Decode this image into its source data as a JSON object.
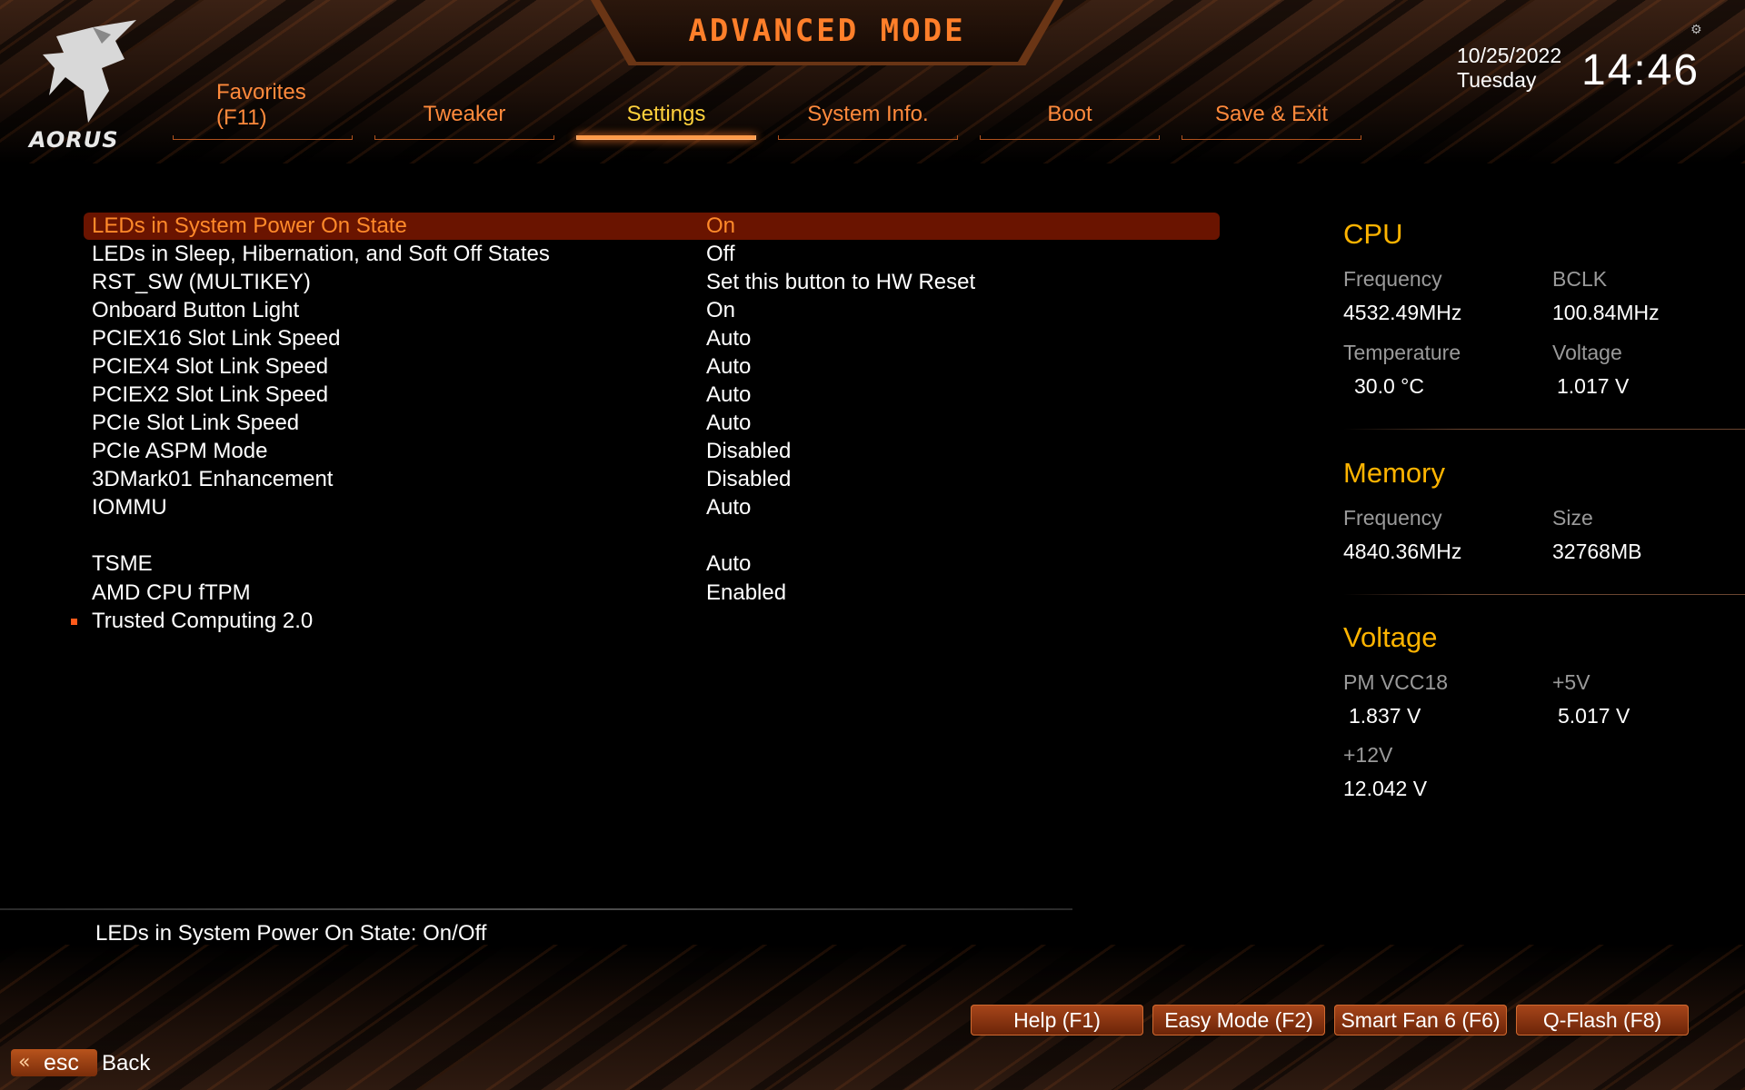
{
  "header": {
    "logo_text": "AORUS",
    "mode_title": "ADVANCED MODE",
    "date": "10/25/2022",
    "day": "Tuesday",
    "time": "14:46",
    "tabs": [
      {
        "label_line1": "Favorites",
        "label_line2": "(F11)"
      },
      {
        "label": "Tweaker"
      },
      {
        "label": "Settings"
      },
      {
        "label": "System Info."
      },
      {
        "label": "Boot"
      },
      {
        "label": "Save & Exit"
      }
    ]
  },
  "settings": [
    {
      "label": "LEDs in System Power On State",
      "value": "On"
    },
    {
      "label": "LEDs in Sleep, Hibernation, and Soft Off States",
      "value": "Off"
    },
    {
      "label": "RST_SW (MULTIKEY)",
      "value": "Set this button to HW Reset"
    },
    {
      "label": "Onboard Button Light",
      "value": "On"
    },
    {
      "label": "PCIEX16 Slot Link Speed",
      "value": "Auto"
    },
    {
      "label": "PCIEX4 Slot Link Speed",
      "value": "Auto"
    },
    {
      "label": "PCIEX2 Slot Link Speed",
      "value": "Auto"
    },
    {
      "label": "PCIe Slot Link Speed",
      "value": "Auto"
    },
    {
      "label": "PCIe ASPM Mode",
      "value": "Disabled"
    },
    {
      "label": "3DMark01 Enhancement",
      "value": "Disabled"
    },
    {
      "label": "IOMMU",
      "value": "Auto"
    },
    {
      "label": "TSME",
      "value": "Auto"
    },
    {
      "label": "AMD CPU fTPM",
      "value": "Enabled"
    },
    {
      "label": "Trusted Computing 2.0",
      "value": ""
    }
  ],
  "panel": {
    "cpu": {
      "title": "CPU",
      "frequency_label": "Frequency",
      "frequency": "4532.49MHz",
      "bclk_label": "BCLK",
      "bclk": "100.84MHz",
      "temperature_label": "Temperature",
      "temperature": "30.0 °C",
      "voltage_label": "Voltage",
      "voltage": "1.017 V"
    },
    "memory": {
      "title": "Memory",
      "frequency_label": "Frequency",
      "frequency": "4840.36MHz",
      "size_label": "Size",
      "size": "32768MB"
    },
    "voltage": {
      "title": "Voltage",
      "pm_vcc18_label": "PM VCC18",
      "pm_vcc18": "1.837 V",
      "plus5v_label": "+5V",
      "plus5v": "5.017 V",
      "plus12v_label": "+12V",
      "plus12v": "12.042 V"
    }
  },
  "help_text": "LEDs in System Power On State: On/Off",
  "footer": {
    "buttons": [
      "Help (F1)",
      "Easy Mode (F2)",
      "Smart Fan 6 (F6)",
      "Q-Flash (F8)"
    ],
    "esc_label": "esc",
    "back_label": "Back"
  },
  "colors": {
    "accent": "#ff8a3c",
    "active_tab": "#ffd23c",
    "section_title": "#ffb400",
    "selected_row_bg": "#6a1400"
  }
}
